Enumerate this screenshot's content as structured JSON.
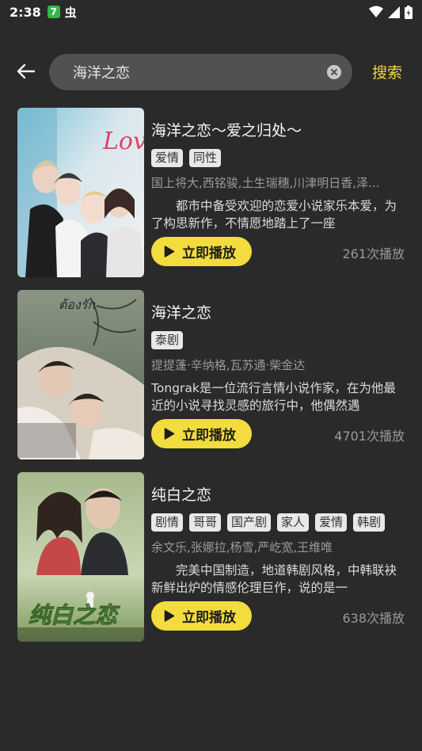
{
  "status_bar": {
    "time": "2:38",
    "app_badge": "7",
    "bug_glyph": "虫"
  },
  "search": {
    "query": "海洋之恋",
    "submit_label": "搜索"
  },
  "play_label": "立即播放",
  "results": [
    {
      "title": "海洋之恋～爱之归处～",
      "tags": [
        "爱情",
        "同性"
      ],
      "cast": "国上将大,西铭骏,土生瑞穗,川津明日香,泽...",
      "description": "　　都市中备受欢迎的恋爱小说家乐本爱，为了构思新作，不情愿地踏上了一座",
      "play_count": "261次播放",
      "poster_text": "Love S"
    },
    {
      "title": "海洋之恋",
      "tags": [
        "泰剧"
      ],
      "cast": "提提蓬·辛纳格,瓦苏通·柴金达",
      "description": "Tongrak是一位流行言情小说作家，在为他最近的小说寻找灵感的旅行中，他偶然遇",
      "play_count": "4701次播放",
      "poster_text": "ต้องรัก"
    },
    {
      "title": "纯白之恋",
      "tags": [
        "剧情",
        "哥哥",
        "国产剧",
        "家人",
        "爱情",
        "韩剧"
      ],
      "cast": "余文乐,张娜拉,杨雪,严屹宽,王维唯",
      "description": "　　完美中国制造，地道韩剧风格，中韩联袂新鲜出炉的情感伦理巨作，说的是一",
      "play_count": "638次播放",
      "poster_text": "纯白之恋"
    }
  ]
}
